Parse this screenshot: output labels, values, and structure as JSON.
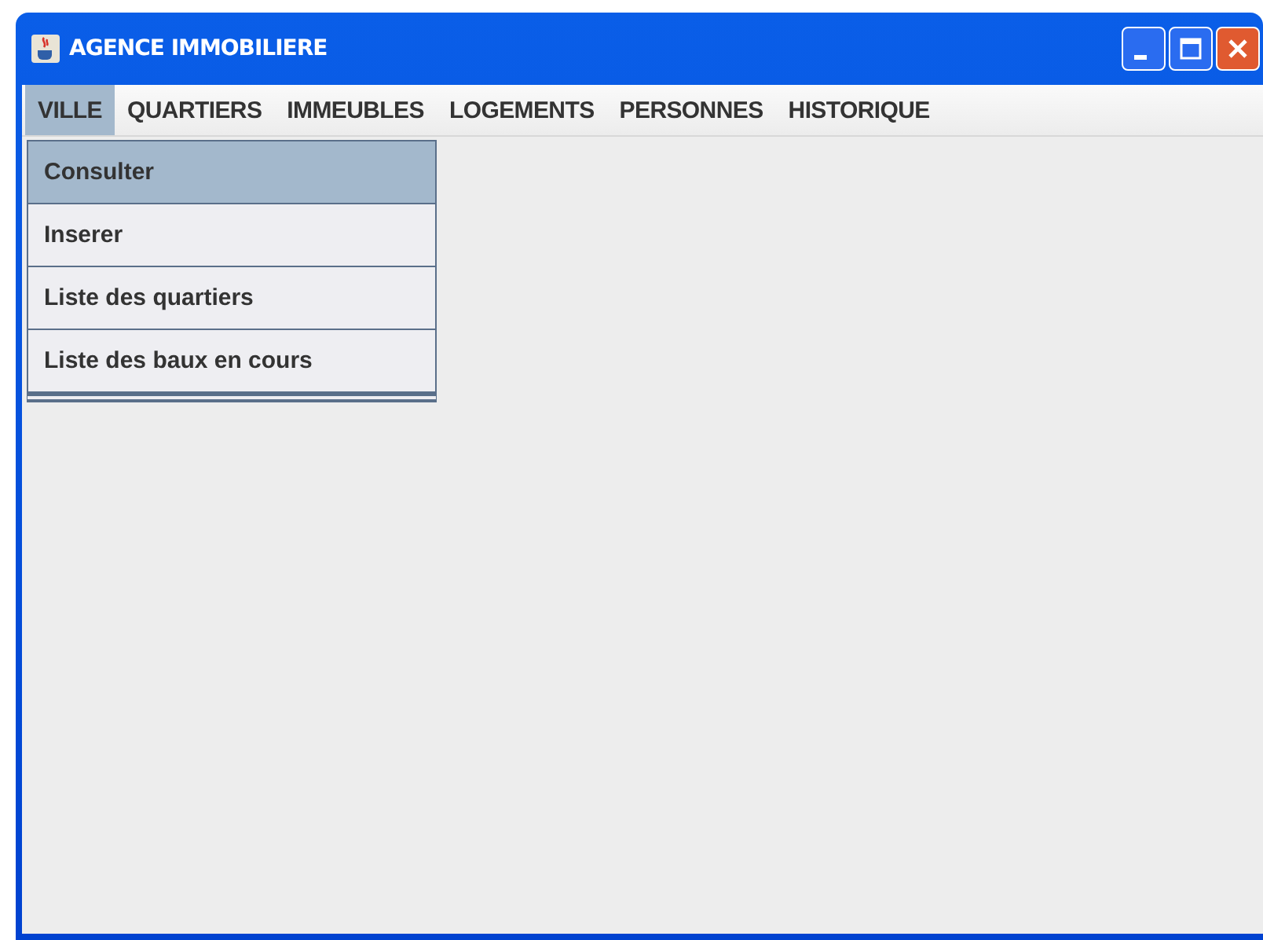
{
  "window": {
    "title": "AGENCE IMMOBILIERE"
  },
  "menu_bar": [
    {
      "label": "VILLE",
      "selected": true
    },
    {
      "label": "QUARTIERS",
      "selected": false
    },
    {
      "label": "IMMEUBLES",
      "selected": false
    },
    {
      "label": "LOGEMENTS",
      "selected": false
    },
    {
      "label": "PERSONNES",
      "selected": false
    },
    {
      "label": "HISTORIQUE",
      "selected": false
    }
  ],
  "dropdown": [
    {
      "label": "Consulter",
      "selected": true
    },
    {
      "label": "Inserer",
      "selected": false
    },
    {
      "label": "Liste des quartiers",
      "selected": false
    },
    {
      "label": "Liste des baux en cours",
      "selected": false
    }
  ]
}
